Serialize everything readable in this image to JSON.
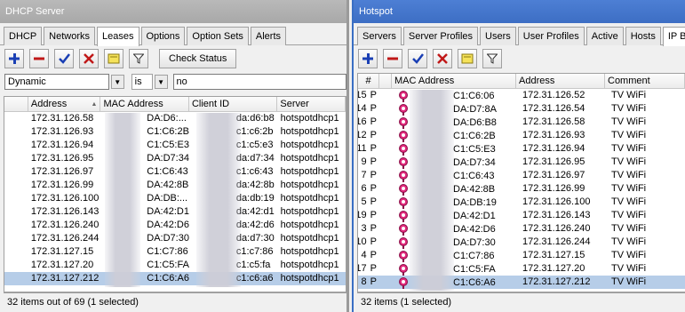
{
  "left": {
    "title": "DHCP Server",
    "tabs": [
      "DHCP",
      "Networks",
      "Leases",
      "Options",
      "Option Sets",
      "Alerts"
    ],
    "active_tab": 2,
    "toolbar": {
      "check_status": "Check Status"
    },
    "filter": {
      "field": "Dynamic",
      "op": "is",
      "value": "no"
    },
    "columns": [
      "Address",
      "MAC Address",
      "Client ID",
      "Server"
    ],
    "rows": [
      {
        "address": "172.31.126.58",
        "mac": "DA:D6:...",
        "client": "da:d6:b8",
        "server": "hotspotdhcp1"
      },
      {
        "address": "172.31.126.93",
        "mac": "C1:C6:2B",
        "client": "c1:c6:2b",
        "server": "hotspotdhcp1"
      },
      {
        "address": "172.31.126.94",
        "mac": "C1:C5:E3",
        "client": "c1:c5:e3",
        "server": "hotspotdhcp1"
      },
      {
        "address": "172.31.126.95",
        "mac": "DA:D7:34",
        "client": "da:d7:34",
        "server": "hotspotdhcp1"
      },
      {
        "address": "172.31.126.97",
        "mac": "C1:C6:43",
        "client": "c1:c6:43",
        "server": "hotspotdhcp1"
      },
      {
        "address": "172.31.126.99",
        "mac": "DA:42:8B",
        "client": "da:42:8b",
        "server": "hotspotdhcp1"
      },
      {
        "address": "172.31.126.100",
        "mac": "DA:DB:...",
        "client": "da:db:19",
        "server": "hotspotdhcp1"
      },
      {
        "address": "172.31.126.143",
        "mac": "DA:42:D1",
        "client": "da:42:d1",
        "server": "hotspotdhcp1"
      },
      {
        "address": "172.31.126.240",
        "mac": "DA:42:D6",
        "client": "da:42:d6",
        "server": "hotspotdhcp1"
      },
      {
        "address": "172.31.126.244",
        "mac": "DA:D7:30",
        "client": "da:d7:30",
        "server": "hotspotdhcp1"
      },
      {
        "address": "172.31.127.15",
        "mac": "C1:C7:86",
        "client": "c1:c7:86",
        "server": "hotspotdhcp1"
      },
      {
        "address": "172.31.127.20",
        "mac": "C1:C5:FA",
        "client": "c1:c5:fa",
        "server": "hotspotdhcp1"
      },
      {
        "address": "172.31.127.212",
        "mac": "C1:C6:A6",
        "client": "c1:c6:a6",
        "server": "hotspotdhcp1"
      }
    ],
    "selected_row": 12,
    "status": "32 items out of 69 (1 selected)"
  },
  "right": {
    "title": "Hotspot",
    "tabs": [
      "Servers",
      "Server Profiles",
      "Users",
      "User Profiles",
      "Active",
      "Hosts",
      "IP Binding"
    ],
    "active_tab": 6,
    "columns": [
      "#",
      "",
      "MAC Address",
      "Address",
      "Comment"
    ],
    "rows": [
      {
        "num": "15",
        "flag": "P",
        "mac": "C1:C6:06",
        "address": "172.31.126.52",
        "comment": "TV WiFi"
      },
      {
        "num": "14",
        "flag": "P",
        "mac": "DA:D7:8A",
        "address": "172.31.126.54",
        "comment": "TV WiFi"
      },
      {
        "num": "16",
        "flag": "P",
        "mac": "DA:D6:B8",
        "address": "172.31.126.58",
        "comment": "TV WiFi"
      },
      {
        "num": "12",
        "flag": "P",
        "mac": "C1:C6:2B",
        "address": "172.31.126.93",
        "comment": "TV WiFi"
      },
      {
        "num": "11",
        "flag": "P",
        "mac": "C1:C5:E3",
        "address": "172.31.126.94",
        "comment": "TV WiFi"
      },
      {
        "num": "9",
        "flag": "P",
        "mac": "DA:D7:34",
        "address": "172.31.126.95",
        "comment": "TV WiFi"
      },
      {
        "num": "7",
        "flag": "P",
        "mac": "C1:C6:43",
        "address": "172.31.126.97",
        "comment": "TV WiFi"
      },
      {
        "num": "6",
        "flag": "P",
        "mac": "DA:42:8B",
        "address": "172.31.126.99",
        "comment": "TV WiFi"
      },
      {
        "num": "5",
        "flag": "P",
        "mac": "DA:DB:19",
        "address": "172.31.126.100",
        "comment": "TV WiFi"
      },
      {
        "num": "19",
        "flag": "P",
        "mac": "DA:42:D1",
        "address": "172.31.126.143",
        "comment": "TV WiFi"
      },
      {
        "num": "3",
        "flag": "P",
        "mac": "DA:42:D6",
        "address": "172.31.126.240",
        "comment": "TV WiFi"
      },
      {
        "num": "10",
        "flag": "P",
        "mac": "DA:D7:30",
        "address": "172.31.126.244",
        "comment": "TV WiFi"
      },
      {
        "num": "4",
        "flag": "P",
        "mac": "C1:C7:86",
        "address": "172.31.127.15",
        "comment": "TV WiFi"
      },
      {
        "num": "17",
        "flag": "P",
        "mac": "C1:C5:FA",
        "address": "172.31.127.20",
        "comment": "TV WiFi"
      },
      {
        "num": "8",
        "flag": "P",
        "mac": "C1:C6:A6",
        "address": "172.31.127.212",
        "comment": "TV WiFi"
      }
    ],
    "selected_row": 14,
    "status": "32 items (1 selected)"
  },
  "colors": {
    "selection": "#b6cde8",
    "title_active": "#3d6ec4",
    "add": "#1a3fb4",
    "remove": "#c01818"
  }
}
